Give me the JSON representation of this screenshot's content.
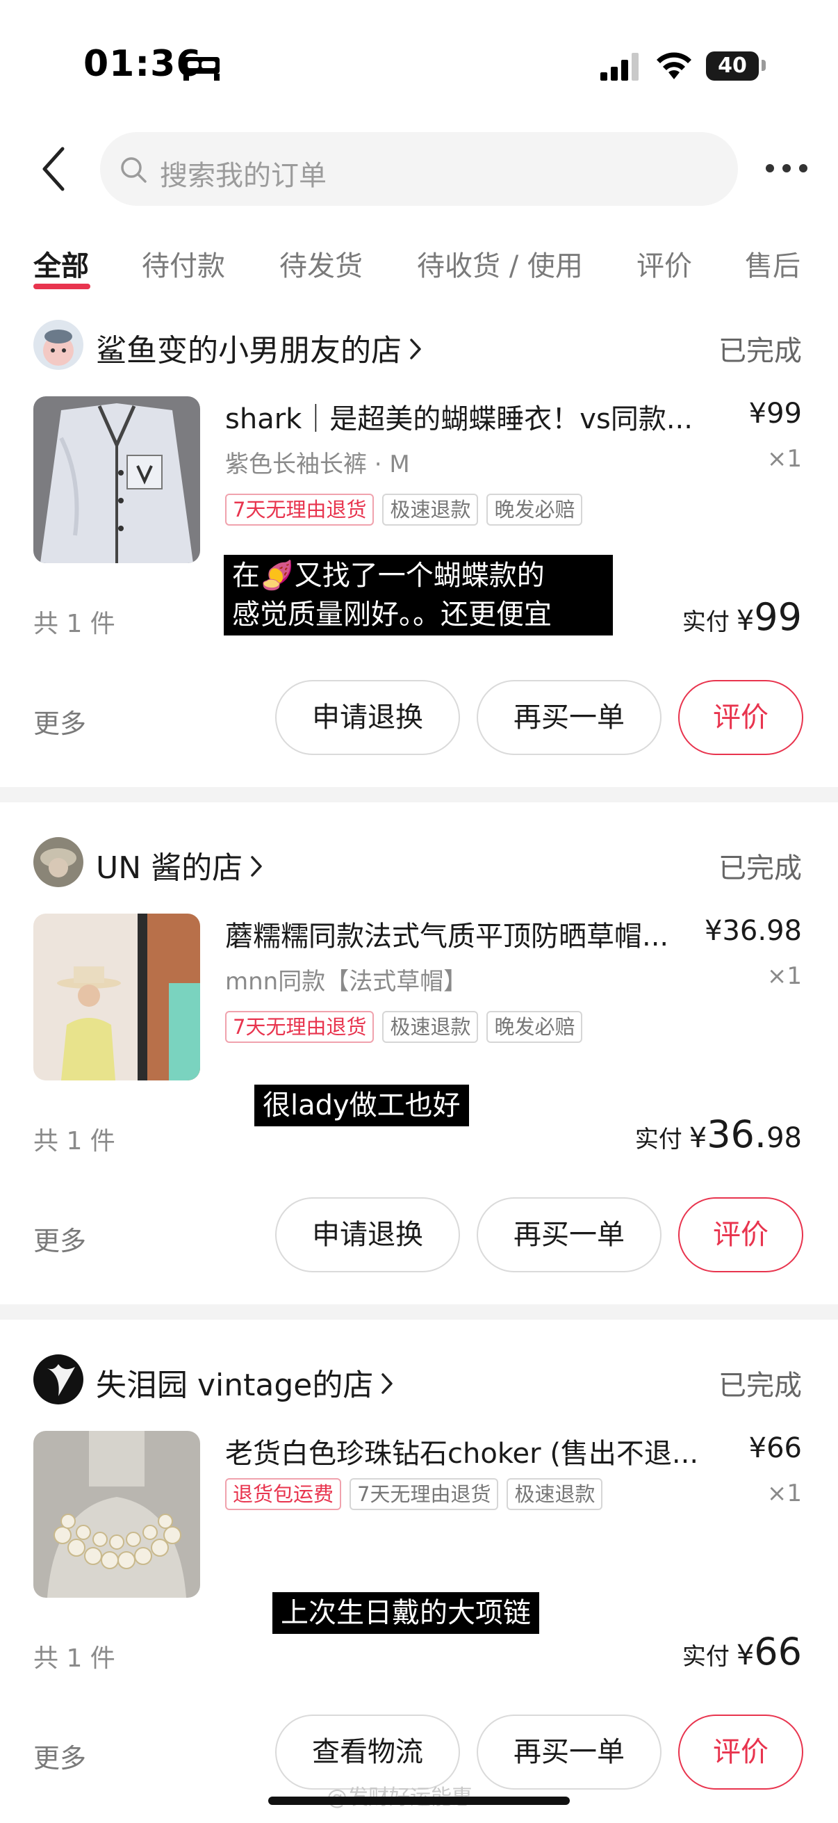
{
  "status_bar": {
    "time": "01:36",
    "battery": "40"
  },
  "header": {
    "search_placeholder": "搜索我的订单"
  },
  "tabs": [
    {
      "label": "全部"
    },
    {
      "label": "待付款"
    },
    {
      "label": "待发货"
    },
    {
      "label": "待收货 / 使用"
    },
    {
      "label": "评价"
    },
    {
      "label": "售后"
    }
  ],
  "colors": {
    "accent": "#e8344e",
    "muted": "#8a8a8a",
    "divider": "#f3f3f3"
  },
  "orders": [
    {
      "shop_name": "鲨鱼变的小男朋友的店",
      "status": "已完成",
      "product_title": "shark｜是超美的蝴蝶睡衣！vs同款...",
      "price": "¥99",
      "sku": "紫色长袖长裤 · M",
      "qty": "×1",
      "tags": [
        "7天无理由退货",
        "极速退款",
        "晚发必赔"
      ],
      "caption_line1": "在🍠又找了一个蝴蝶款的",
      "caption_line2": "感觉质量刚好。。还更便宜",
      "count": "共 1 件",
      "paid_label": "实付",
      "paid_currency": "¥",
      "paid_int": "99",
      "paid_dec": "",
      "more": "更多",
      "buttons": [
        "申请退换",
        "再买一单",
        "评价"
      ]
    },
    {
      "shop_name": "UN 酱的店",
      "status": "已完成",
      "product_title": "蘑糯糯同款法式气质平顶防晒草帽...",
      "price": "¥36.98",
      "sku": "mnn同款【法式草帽】",
      "qty": "×1",
      "tags": [
        "7天无理由退货",
        "极速退款",
        "晚发必赔"
      ],
      "caption_line1": "很lady做工也好",
      "count": "共 1 件",
      "paid_label": "实付",
      "paid_currency": "¥",
      "paid_int": "36.",
      "paid_dec": "98",
      "more": "更多",
      "buttons": [
        "申请退换",
        "再买一单",
        "评价"
      ]
    },
    {
      "shop_name": "失泪园 vintage的店",
      "status": "已完成",
      "product_title": "老货白色珍珠钻石choker (售出不退...",
      "price": "¥66",
      "qty": "×1",
      "tags": [
        "退货包运费",
        "7天无理由退货",
        "极速退款"
      ],
      "caption_line1": "上次生日戴的大项链",
      "count": "共 1 件",
      "paid_label": "实付",
      "paid_currency": "¥",
      "paid_int": "66",
      "paid_dec": "",
      "more": "更多",
      "buttons": [
        "查看物流",
        "再买一单",
        "评价"
      ]
    }
  ],
  "watermark": "@发财好运能惠"
}
